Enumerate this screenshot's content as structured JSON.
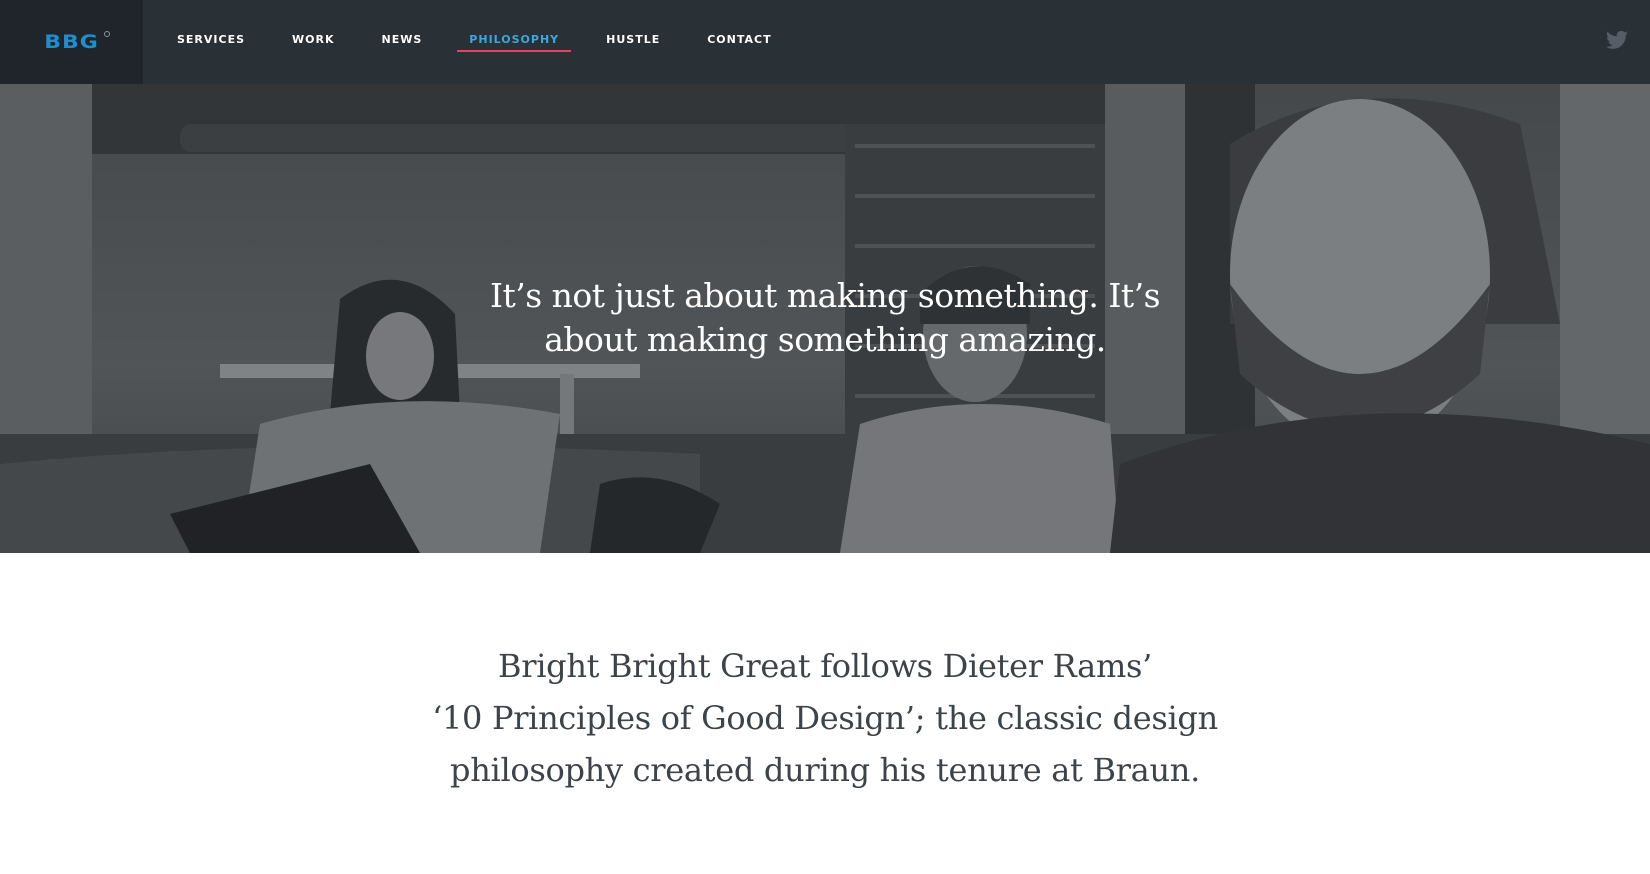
{
  "brand": {
    "logo_text": "BBG",
    "accent_color": "#1e8fcc",
    "active_underline_color": "#e0445f"
  },
  "nav": {
    "items": [
      {
        "label": "SERVICES"
      },
      {
        "label": "WORK"
      },
      {
        "label": "NEWS"
      },
      {
        "label": "PHILOSOPHY",
        "active": true
      },
      {
        "label": "HUSTLE"
      },
      {
        "label": "CONTACT"
      }
    ],
    "social_icon": "twitter-icon"
  },
  "hero": {
    "quote_line1": "It’s not just about making something. It’s",
    "quote_line2": "about making something amazing."
  },
  "intro": {
    "line1": "Bright Bright Great follows Dieter Rams’",
    "line2": "‘10 Principles of Good Design’; the classic design",
    "line3": "philosophy created during his tenure at Braun."
  }
}
